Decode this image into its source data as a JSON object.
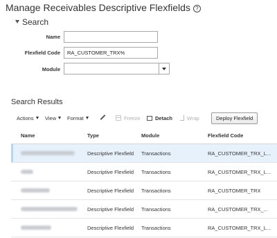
{
  "page": {
    "title": "Manage Receivables Descriptive Flexfields",
    "help_icon": "?"
  },
  "search": {
    "header": "Search",
    "name_label": "Name",
    "name_value": "",
    "code_label": "Flexfield Code",
    "code_value": "RA_CUSTOMER_TRX%",
    "module_label": "Module",
    "module_value": ""
  },
  "results": {
    "header": "Search Results",
    "toolbar": {
      "actions": "Actions",
      "view": "View",
      "format": "Format",
      "freeze": "Freeze",
      "detach": "Detach",
      "wrap": "Wrap",
      "deploy": "Deploy Flexfield"
    },
    "columns": {
      "name": "Name",
      "type": "Type",
      "module": "Module",
      "code": "Flexfield Code"
    },
    "rows": [
      {
        "type": "Descriptive Flexfield",
        "module": "Transactions",
        "code": "RA_CUSTOMER_TRX_L...",
        "selected": true
      },
      {
        "type": "Descriptive Flexfield",
        "module": "Transactions",
        "code": "RA_CUSTOMER_TRX_L...",
        "selected": false
      },
      {
        "type": "Descriptive Flexfield",
        "module": "Transactions",
        "code": "RA_CUSTOMER_TRX",
        "selected": false
      },
      {
        "type": "Descriptive Flexfield",
        "module": "Transactions",
        "code": "RA_CUSTOMER_TRX_...",
        "selected": false
      },
      {
        "type": "Descriptive Flexfield",
        "module": "Transactions",
        "code": "RA_CUSTOMER_TRX_L...",
        "selected": false
      }
    ]
  },
  "colors": {
    "selected_row": "#e6f1fb",
    "border": "#a8a8a8"
  }
}
